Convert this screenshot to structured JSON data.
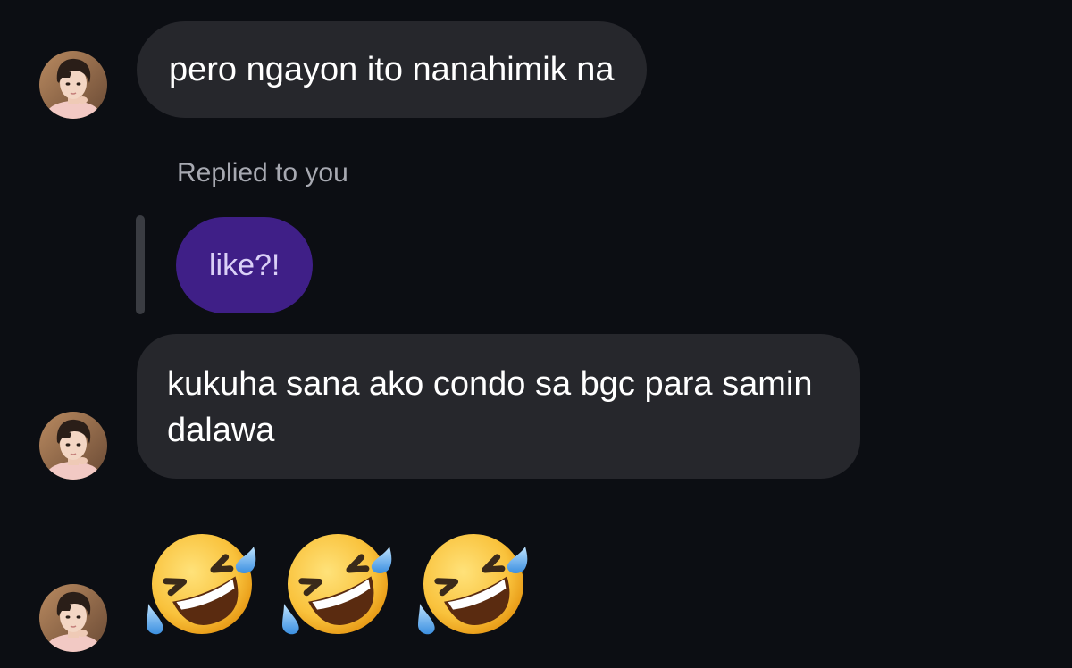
{
  "conversation": {
    "messages": [
      {
        "sender": "other",
        "text": "pero ngayon ito nanahimik na"
      },
      {
        "sender": "other",
        "reply_label": "Replied to you",
        "quoted_text": "like?!",
        "text": "kukuha sana ako condo sa bgc para samin dalawa"
      },
      {
        "sender": "other",
        "emoji": "rolling-on-the-floor-laughing",
        "emoji_count": 3
      }
    ]
  },
  "colors": {
    "background": "#0c0e13",
    "incoming_bubble": "#26272c",
    "own_bubble_quote": "#3f1f87",
    "reply_label": "#a7a9b1"
  }
}
